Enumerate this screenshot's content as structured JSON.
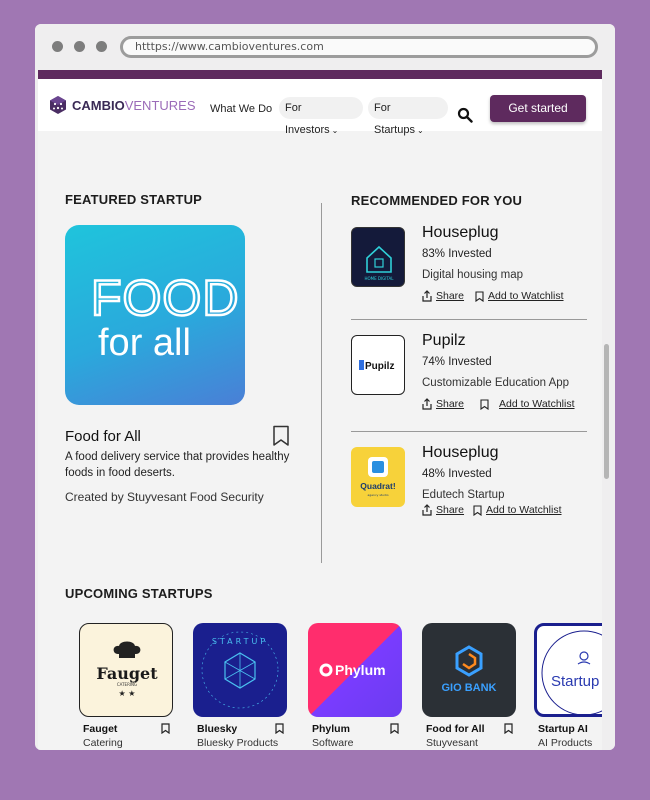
{
  "browser": {
    "url": "htttps://www.cambioventures.com"
  },
  "nav": {
    "brand_a": "CAMBIO",
    "brand_b": "VENTURES",
    "what_we_do": "What We Do",
    "for_investors": "For Investors",
    "for_startups": "For Startups",
    "cta": "Get started"
  },
  "featured": {
    "heading": "FEATURED STARTUP",
    "logo_line1": "FOOD",
    "logo_line2": "for all",
    "name": "Food for All",
    "description": "A food delivery service that provides healthy foods in food deserts.",
    "created_by": "Created by Stuyvesant Food Security"
  },
  "recommended": {
    "heading": "RECOMMENDED FOR YOU",
    "share_label": "Share",
    "watch_label": "Add to Watchlist",
    "items": [
      {
        "name": "Houseplug",
        "invested": "83% Invested",
        "description": "Digital housing map",
        "logo_text": "HOME DIGITAL"
      },
      {
        "name": "Pupilz",
        "invested": "74% Invested",
        "description": "Customizable Education App",
        "logo_text": "Pupilz"
      },
      {
        "name": "Houseplug",
        "invested": "48% Invested",
        "description": "Edutech Startup",
        "logo_text": "Quadrat!",
        "logo_sub": "agency studio"
      }
    ]
  },
  "upcoming": {
    "heading": "UPCOMING STARTUPS",
    "items": [
      {
        "name": "Fauget",
        "category": "Catering Company",
        "logo_text": "Fauget",
        "logo_sub": "CATERING"
      },
      {
        "name": "Bluesky",
        "category": "Bluesky Products",
        "logo_text": "STARTUP"
      },
      {
        "name": "Phylum",
        "category": "Software Supply Chain",
        "logo_text": "Phylum"
      },
      {
        "name": "Food for All",
        "category": "Stuyvesant Food Security",
        "logo_text": "GIO BANK"
      },
      {
        "name": "Startup AI",
        "category": "AI Products",
        "logo_text": "Startup"
      }
    ]
  },
  "colors": {
    "brand": "#5e2a5e",
    "background": "#a077b3",
    "featured_gradient_start": "#1fc4dc",
    "featured_gradient_end": "#4a7fd6"
  }
}
